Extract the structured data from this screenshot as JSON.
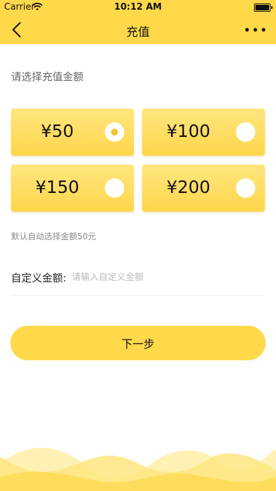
{
  "status_bar": {
    "carrier": "Carrier",
    "time": "10:12 AM"
  },
  "nav": {
    "title": "充值",
    "back_icon": "chevron-left-icon",
    "more_icon": "more-dots-icon"
  },
  "section_title": "请选择充值金额",
  "amounts": [
    {
      "label": "¥50",
      "selected": true
    },
    {
      "label": "¥100",
      "selected": false
    },
    {
      "label": "¥150",
      "selected": false
    },
    {
      "label": "¥200",
      "selected": false
    }
  ],
  "hint": "默认自动选择金额50元",
  "custom": {
    "label": "自定义金额:",
    "placeholder": "请输入自定义金额",
    "value": ""
  },
  "next_button": "下一步",
  "colors": {
    "accent": "#ffd94a",
    "card_top": "#ffe680",
    "card_bottom": "#ffd64a",
    "radio_dot": "#f0c236"
  }
}
